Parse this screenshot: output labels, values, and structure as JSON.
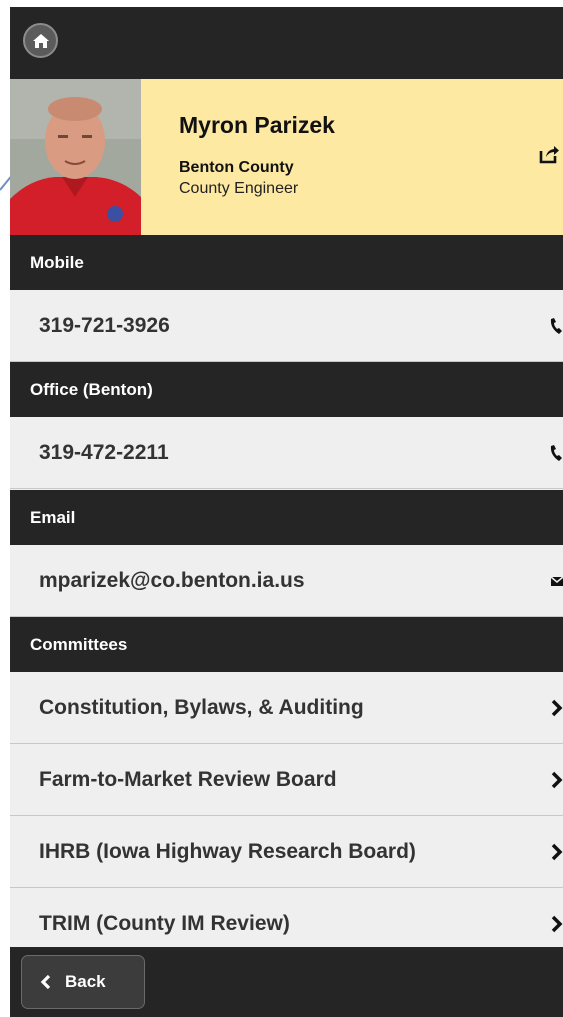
{
  "profile": {
    "name": "Myron Parizek",
    "county": "Benton County",
    "title": "County Engineer"
  },
  "sections": [
    {
      "header": "Mobile",
      "items": [
        {
          "label": "319-721-3926",
          "icon": "phone-icon"
        }
      ]
    },
    {
      "header": "Office (Benton)",
      "items": [
        {
          "label": "319-472-2211",
          "icon": "phone-icon"
        }
      ]
    },
    {
      "header": "Email",
      "items": [
        {
          "label": "mparizek@co.benton.ia.us",
          "icon": "mail-icon"
        }
      ]
    },
    {
      "header": "Committees",
      "items": [
        {
          "label": "Constitution, Bylaws, & Auditing",
          "icon": "chevron-right-icon"
        },
        {
          "label": "Farm-to-Market Review Board",
          "icon": "chevron-right-icon"
        },
        {
          "label": "IHRB (Iowa Highway Research Board)",
          "icon": "chevron-right-icon"
        },
        {
          "label": "TRIM (County IM Review)",
          "icon": "chevron-right-icon"
        }
      ]
    }
  ],
  "footer": {
    "back_label": "Back"
  },
  "colors": {
    "bar": "#252525",
    "profile_bg": "#fde9a2",
    "row_bg": "#efefef",
    "text": "#333333"
  }
}
